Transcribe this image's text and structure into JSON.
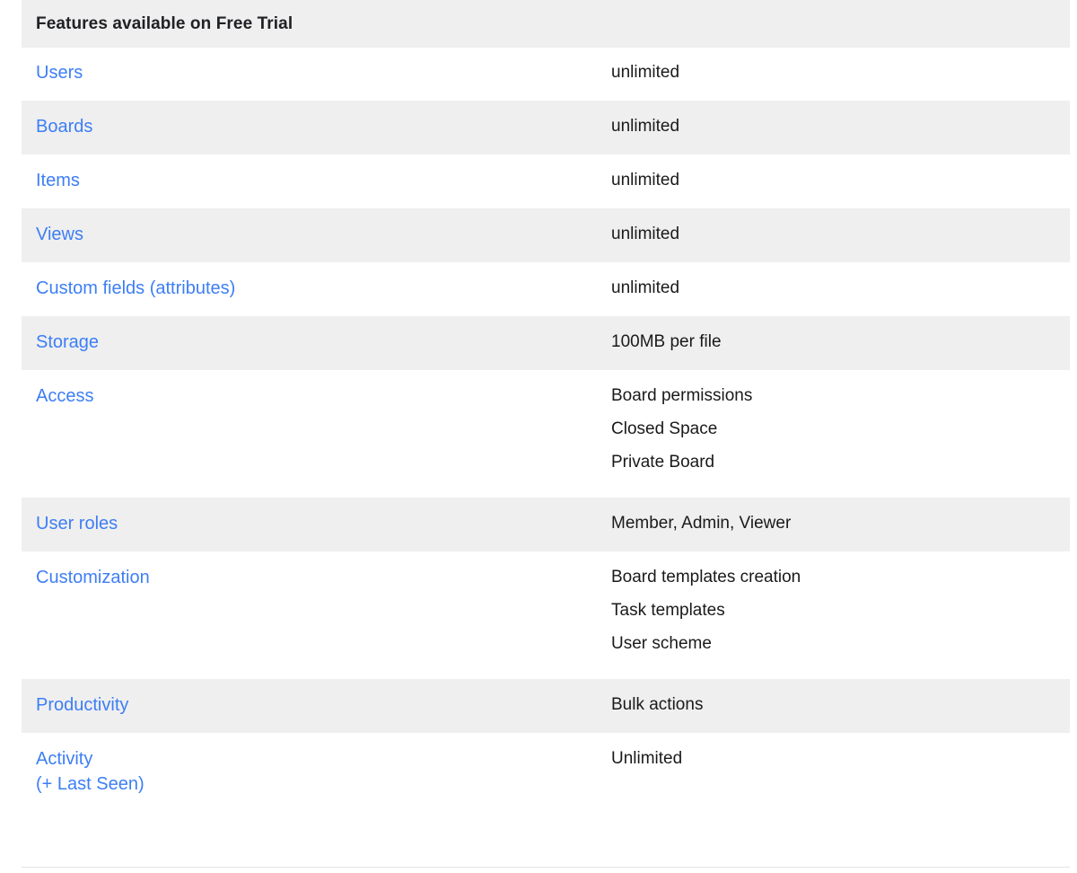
{
  "table": {
    "header": {
      "title": "Features available on Free Trial"
    },
    "rows": [
      {
        "id": "users",
        "feature": "Users",
        "feature_sub": "",
        "values": [
          "unlimited"
        ],
        "shaded": false
      },
      {
        "id": "boards",
        "feature": "Boards",
        "feature_sub": "",
        "values": [
          "unlimited"
        ],
        "shaded": true
      },
      {
        "id": "items",
        "feature": "Items",
        "feature_sub": "",
        "values": [
          "unlimited"
        ],
        "shaded": false
      },
      {
        "id": "views",
        "feature": "Views",
        "feature_sub": "",
        "values": [
          "unlimited"
        ],
        "shaded": true
      },
      {
        "id": "custom-fields",
        "feature": "Custom fields (attributes)",
        "feature_sub": "",
        "values": [
          "unlimited"
        ],
        "shaded": false
      },
      {
        "id": "storage",
        "feature": "Storage",
        "feature_sub": "",
        "values": [
          "100MB per file"
        ],
        "shaded": true
      },
      {
        "id": "access",
        "feature": "Access",
        "feature_sub": "",
        "values": [
          "Board permissions",
          "Closed Space",
          "Private Board"
        ],
        "shaded": false
      },
      {
        "id": "user-roles",
        "feature": "User roles",
        "feature_sub": "",
        "values": [
          "Member, Admin, Viewer"
        ],
        "shaded": true
      },
      {
        "id": "customization",
        "feature": "Customization",
        "feature_sub": "",
        "values": [
          "Board templates creation",
          "Task templates",
          "User scheme"
        ],
        "shaded": false
      },
      {
        "id": "productivity",
        "feature": "Productivity",
        "feature_sub": "",
        "values": [
          "Bulk actions"
        ],
        "shaded": true
      },
      {
        "id": "activity",
        "feature": "Activity",
        "feature_sub": "(+ Last Seen)",
        "values": [
          "Unlimited"
        ],
        "shaded": false
      }
    ]
  },
  "colors": {
    "link": "#3d7ef5",
    "shaded_row": "#efefef",
    "plain_row": "#ffffff",
    "text": "#1a1a1a",
    "header_text": "#202124",
    "divider": "#e4e4e4"
  }
}
